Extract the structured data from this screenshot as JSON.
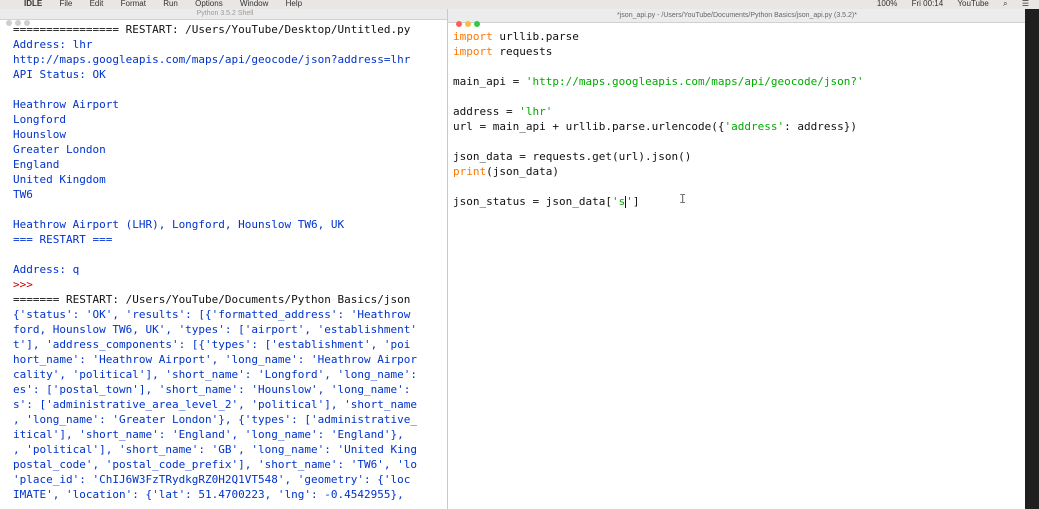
{
  "menubar": {
    "apple_icon": "apple-icon",
    "app_name": "IDLE",
    "menus": [
      "File",
      "Edit",
      "Format",
      "Run",
      "Options",
      "Window",
      "Help"
    ],
    "battery": "100%",
    "clock": "Fri 00:14",
    "user": "YouTube"
  },
  "shell": {
    "title": "Python 3.5.2 Shell",
    "lines": [
      {
        "text": "================ RESTART: /Users/YouTube/Desktop/Untitled.py",
        "style": "plain"
      },
      {
        "text": "Address: lhr",
        "style": "out"
      },
      {
        "text": "http://maps.googleapis.com/maps/api/geocode/json?address=lhr",
        "style": "out"
      },
      {
        "text": "API Status: OK",
        "style": "out"
      },
      {
        "text": "",
        "style": "out"
      },
      {
        "text": "Heathrow Airport",
        "style": "out"
      },
      {
        "text": "Longford",
        "style": "out"
      },
      {
        "text": "Hounslow",
        "style": "out"
      },
      {
        "text": "Greater London",
        "style": "out"
      },
      {
        "text": "England",
        "style": "out"
      },
      {
        "text": "United Kingdom",
        "style": "out"
      },
      {
        "text": "TW6",
        "style": "out"
      },
      {
        "text": "",
        "style": "out"
      },
      {
        "text": "Heathrow Airport (LHR), Longford, Hounslow TW6, UK",
        "style": "out"
      },
      {
        "text": "=== RESTART ===",
        "style": "out"
      },
      {
        "text": "",
        "style": "out"
      },
      {
        "text": "Address: q",
        "style": "out"
      },
      {
        "text": ">>>",
        "style": "err"
      },
      {
        "text": "======= RESTART: /Users/YouTube/Documents/Python Basics/json",
        "style": "plain"
      },
      {
        "text": "{'status': 'OK', 'results': [{'formatted_address': 'Heathrow",
        "style": "out"
      },
      {
        "text": "ford, Hounslow TW6, UK', 'types': ['airport', 'establishment'",
        "style": "out"
      },
      {
        "text": "t'], 'address_components': [{'types': ['establishment', 'poi",
        "style": "out"
      },
      {
        "text": "hort_name': 'Heathrow Airport', 'long_name': 'Heathrow Airpor",
        "style": "out"
      },
      {
        "text": "cality', 'political'], 'short_name': 'Longford', 'long_name':",
        "style": "out"
      },
      {
        "text": "es': ['postal_town'], 'short_name': 'Hounslow', 'long_name':",
        "style": "out"
      },
      {
        "text": "s': ['administrative_area_level_2', 'political'], 'short_name",
        "style": "out"
      },
      {
        "text": ", 'long_name': 'Greater London'}, {'types': ['administrative_",
        "style": "out"
      },
      {
        "text": "itical'], 'short_name': 'England', 'long_name': 'England'}, ",
        "style": "out"
      },
      {
        "text": ", 'political'], 'short_name': 'GB', 'long_name': 'United King",
        "style": "out"
      },
      {
        "text": "postal_code', 'postal_code_prefix'], 'short_name': 'TW6', 'lo",
        "style": "out"
      },
      {
        "text": "'place_id': 'ChIJ6W3FzTRydkgRZ0H2Q1VT548', 'geometry': {'loc",
        "style": "out"
      },
      {
        "text": "IMATE', 'location': {'lat': 51.4700223, 'lng': -0.4542955},",
        "style": "out"
      }
    ]
  },
  "editor": {
    "title": "*json_api.py - /Users/YouTube/Documents/Python Basics/json_api.py (3.5.2)*",
    "code": [
      [
        {
          "t": "import",
          "c": "kw"
        },
        {
          "t": " urllib.parse",
          "c": ""
        }
      ],
      [
        {
          "t": "import",
          "c": "kw"
        },
        {
          "t": " requests",
          "c": ""
        }
      ],
      [
        {
          "t": "",
          "c": ""
        }
      ],
      [
        {
          "t": "main_api = ",
          "c": ""
        },
        {
          "t": "'http://maps.googleapis.com/maps/api/geocode/json?'",
          "c": "str"
        }
      ],
      [
        {
          "t": "",
          "c": ""
        }
      ],
      [
        {
          "t": "address = ",
          "c": ""
        },
        {
          "t": "'lhr'",
          "c": "str"
        }
      ],
      [
        {
          "t": "url = main_api + urllib.parse.urlencode({",
          "c": ""
        },
        {
          "t": "'address'",
          "c": "str"
        },
        {
          "t": ": address})",
          "c": ""
        }
      ],
      [
        {
          "t": "",
          "c": ""
        }
      ],
      [
        {
          "t": "json_data = requests.get(url).json()",
          "c": ""
        }
      ],
      [
        {
          "t": "print",
          "c": "kw"
        },
        {
          "t": "(json_data)",
          "c": ""
        }
      ],
      [
        {
          "t": "",
          "c": ""
        }
      ],
      [
        {
          "t": "json_status = json_data[",
          "c": ""
        },
        {
          "t": "'s",
          "c": "str"
        },
        {
          "t": "|cursor|",
          "c": "cursor"
        },
        {
          "t": "'",
          "c": "str"
        },
        {
          "t": "]",
          "c": ""
        }
      ]
    ]
  }
}
